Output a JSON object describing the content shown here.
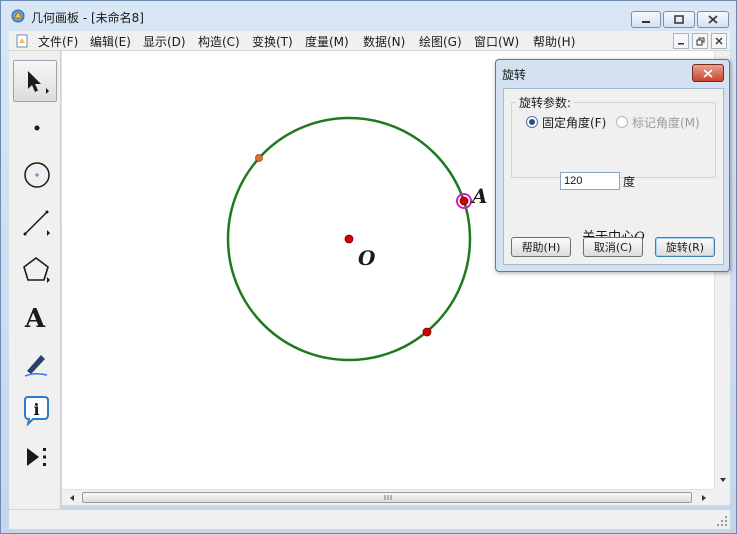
{
  "window": {
    "title": "几何画板 - [未命名8]"
  },
  "menu": [
    {
      "label": "文件(F)"
    },
    {
      "label": "编辑(E)"
    },
    {
      "label": "显示(D)"
    },
    {
      "label": "构造(C)"
    },
    {
      "label": "变换(T)"
    },
    {
      "label": "度量(M)"
    },
    {
      "label": "数据(N)"
    },
    {
      "label": "绘图(G)"
    },
    {
      "label": "窗口(W)"
    },
    {
      "label": "帮助(H)"
    }
  ],
  "tools": [
    {
      "icon": "arrow-select-icon"
    },
    {
      "icon": "point-tool-icon"
    },
    {
      "icon": "compass-tool-icon"
    },
    {
      "icon": "straightedge-tool-icon"
    },
    {
      "icon": "polygon-tool-icon"
    },
    {
      "icon": "text-tool-icon",
      "glyph": "A"
    },
    {
      "icon": "marker-tool-icon"
    },
    {
      "icon": "information-tool-icon",
      "glyph": "i"
    },
    {
      "icon": "custom-tool-icon"
    }
  ],
  "canvas": {
    "point_labels": {
      "center": "O",
      "point_a": "A"
    },
    "colors": {
      "circle": "#1e7a1e",
      "point": "#d40000",
      "selected_ring": "#d020c0"
    }
  },
  "dialog": {
    "title": "旋转",
    "group_label": "旋转参数:",
    "option_fixed": "固定角度(F)",
    "option_marked": "标记角度(M)",
    "angle_value": "120",
    "angle_unit": "度",
    "about_prefix": "关于中心",
    "about_center": "O",
    "buttons": {
      "help": "帮助(H)",
      "cancel": "取消(C)",
      "rotate": "旋转(R)"
    }
  }
}
